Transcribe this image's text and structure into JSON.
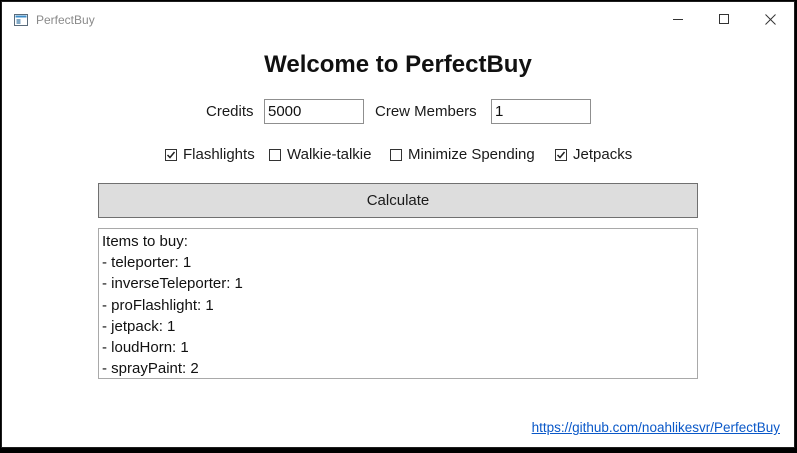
{
  "window": {
    "title": "PerfectBuy",
    "icon": "app-window-icon"
  },
  "heading": "Welcome to PerfectBuy",
  "inputs": {
    "credits_label": "Credits",
    "credits_value": "5000",
    "crew_label": "Crew Members",
    "crew_value": "1"
  },
  "options": [
    {
      "label": "Flashlights",
      "checked": true
    },
    {
      "label": "Walkie-talkie",
      "checked": false
    },
    {
      "label": "Minimize Spending",
      "checked": false
    },
    {
      "label": "Jetpacks",
      "checked": true
    }
  ],
  "calculate_label": "Calculate",
  "output": {
    "lines": [
      "Items to buy:",
      "- teleporter: 1",
      "- inverseTeleporter: 1",
      "- proFlashlight: 1",
      "- jetpack: 1",
      "- loudHorn: 1",
      "- sprayPaint: 2"
    ]
  },
  "link": {
    "text": "https://github.com/noahlikesvr/PerfectBuy"
  },
  "colors": {
    "link": "#0a58c8",
    "button_bg": "#dddddd",
    "window_bg": "#ffffff"
  }
}
